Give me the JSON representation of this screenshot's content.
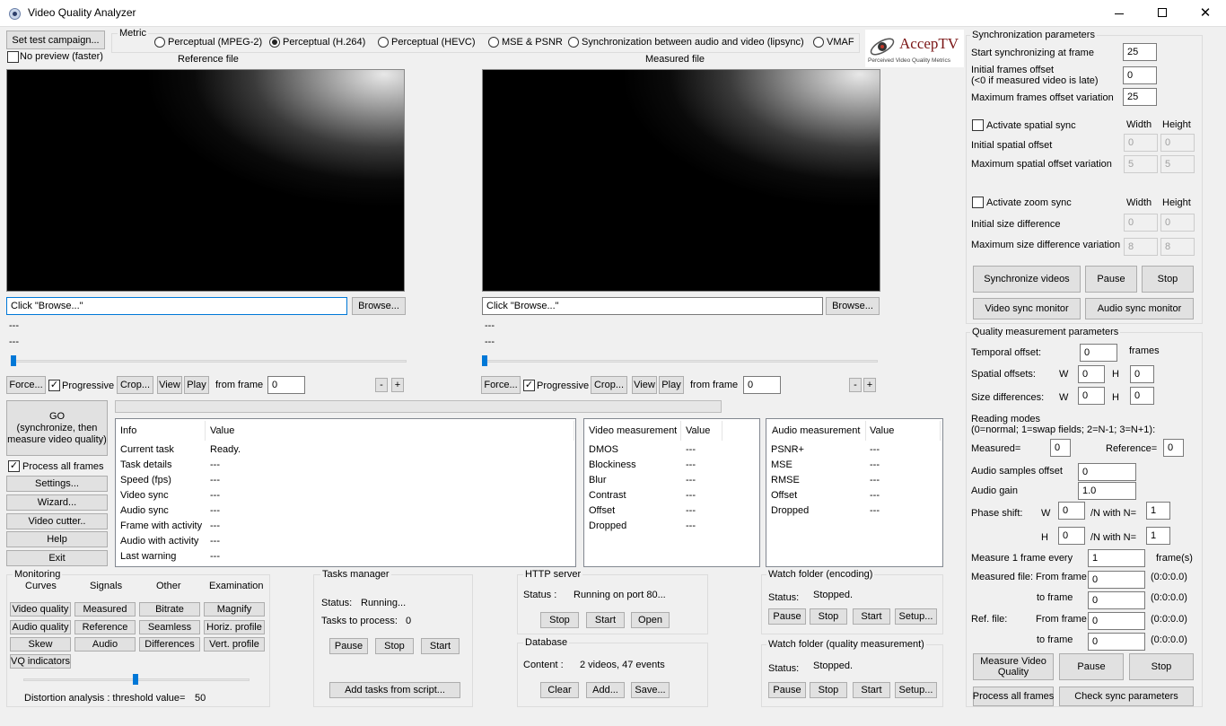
{
  "window": {
    "title": "Video Quality Analyzer"
  },
  "top": {
    "set_test_campaign": "Set test campaign...",
    "no_preview": "No preview (faster)",
    "metric_label": "Metric",
    "metrics": [
      "Perceptual (MPEG-2)",
      "Perceptual (H.264)",
      "Perceptual (HEVC)",
      "MSE & PSNR",
      "Synchronization between audio and video (lipsync)",
      "VMAF"
    ],
    "selected_metric": "Perceptual (H.264)"
  },
  "logo": {
    "name": "AccepTV",
    "tagline": "Perceived Video Quality Metrics"
  },
  "reference": {
    "title": "Reference file",
    "path": "Click \"Browse...\"",
    "browse": "Browse...",
    "info1": "---",
    "info2": "---",
    "force": "Force...",
    "progressive": "Progressive",
    "crop": "Crop...",
    "view": "View",
    "play": "Play",
    "from_frame_label": "from frame",
    "from_frame": "0",
    "minus": "-",
    "plus": "+"
  },
  "measured": {
    "title": "Measured file",
    "path": "Click \"Browse...\"",
    "browse": "Browse...",
    "info1": "---",
    "info2": "---",
    "force": "Force...",
    "progressive": "Progressive",
    "crop": "Crop...",
    "view": "View",
    "play": "Play",
    "from_frame_label": "from frame",
    "from_frame": "0",
    "minus": "-",
    "plus": "+"
  },
  "left_buttons": {
    "go": "GO\n(synchronize, then measure video quality)",
    "process_all_frames": "Process all frames",
    "settings": "Settings...",
    "wizard": "Wizard...",
    "video_cutter": "Video cutter..",
    "help": "Help",
    "exit": "Exit"
  },
  "info_table": {
    "headers": [
      "Info",
      "Value"
    ],
    "rows": [
      [
        "Current task",
        "Ready."
      ],
      [
        "Task details",
        "---"
      ],
      [
        "Speed (fps)",
        "---"
      ],
      [
        "Video sync",
        "---"
      ],
      [
        "Audio sync",
        "---"
      ],
      [
        "Frame with activity",
        "---"
      ],
      [
        "Audio with activity",
        "---"
      ],
      [
        "Last warning",
        "---"
      ]
    ]
  },
  "video_table": {
    "headers": [
      "Video measurement",
      "Value"
    ],
    "rows": [
      [
        "DMOS",
        "---"
      ],
      [
        "Blockiness",
        "---"
      ],
      [
        "Blur",
        "---"
      ],
      [
        "Contrast",
        "---"
      ],
      [
        "Offset",
        "---"
      ],
      [
        "Dropped",
        "---"
      ]
    ]
  },
  "audio_table": {
    "headers": [
      "Audio measurement",
      "Value"
    ],
    "rows": [
      [
        "PSNR+",
        "---"
      ],
      [
        "MSE",
        "---"
      ],
      [
        "RMSE",
        "---"
      ],
      [
        "Offset",
        "---"
      ],
      [
        "Dropped",
        "---"
      ]
    ]
  },
  "monitoring": {
    "title": "Monitoring",
    "cols": [
      "Curves",
      "Signals",
      "Other",
      "Examination"
    ],
    "buttons": [
      "Video quality",
      "Measured",
      "Bitrate",
      "Magnify",
      "Audio quality",
      "Reference",
      "Seamless",
      "Horiz. profile",
      "Skew",
      "Audio",
      "Differences",
      "Vert. profile",
      "VQ indicators"
    ],
    "threshold_label": "Distortion analysis : threshold value=",
    "threshold_value": "50"
  },
  "tasks": {
    "title": "Tasks manager",
    "status_label": "Status:",
    "status": "Running...",
    "to_process_label": "Tasks to process:",
    "to_process": "0",
    "pause": "Pause",
    "stop": "Stop",
    "start": "Start",
    "add_script": "Add tasks from script..."
  },
  "http": {
    "title": "HTTP server",
    "status_label": "Status :",
    "status": "Running on port 80...",
    "stop": "Stop",
    "start": "Start",
    "open": "Open"
  },
  "database": {
    "title": "Database",
    "content_label": "Content :",
    "content": "2 videos, 47 events",
    "clear": "Clear",
    "add": "Add...",
    "save": "Save..."
  },
  "watch_enc": {
    "title": "Watch folder (encoding)",
    "status_label": "Status:",
    "status": "Stopped.",
    "pause": "Pause",
    "stop": "Stop",
    "start": "Start",
    "setup": "Setup..."
  },
  "watch_qm": {
    "title": "Watch folder (quality measurement)",
    "status_label": "Status:",
    "status": "Stopped.",
    "pause": "Pause",
    "stop": "Stop",
    "start": "Start",
    "setup": "Setup..."
  },
  "sync": {
    "title": "Synchronization parameters",
    "start_label": "Start synchronizing at frame",
    "start": "25",
    "init_offset_label": "Initial frames offset",
    "init_offset_note": "(<0 if measured video is late)",
    "init_offset": "0",
    "max_var_label": "Maximum frames offset variation",
    "max_var": "25",
    "spatial_label": "Activate spatial sync",
    "width": "Width",
    "height": "Height",
    "init_spatial_label": "Initial spatial offset",
    "init_spatial_w": "0",
    "init_spatial_h": "0",
    "max_spatial_label": "Maximum spatial offset variation",
    "max_spatial_w": "5",
    "max_spatial_h": "5",
    "zoom_label": "Activate zoom sync",
    "init_size_label": "Initial size difference",
    "init_size_w": "0",
    "init_size_h": "0",
    "max_size_label": "Maximum size difference variation",
    "max_size_w": "8",
    "max_size_h": "8",
    "sync_videos": "Synchronize videos",
    "pause": "Pause",
    "stop": "Stop",
    "video_monitor": "Video sync monitor",
    "audio_monitor": "Audio sync monitor"
  },
  "quality": {
    "title": "Quality measurement parameters",
    "temporal_label": "Temporal offset:",
    "temporal": "0",
    "frames": "frames",
    "spatial_label": "Spatial offsets:",
    "w": "W",
    "h": "H",
    "spatial_w": "0",
    "spatial_h": "0",
    "size_label": "Size differences:",
    "size_w": "0",
    "size_h": "0",
    "reading_label": "Reading modes",
    "reading_note": "(0=normal; 1=swap fields; 2=N-1; 3=N+1):",
    "measured_label": "Measured=",
    "measured": "0",
    "reference_label": "Reference=",
    "reference": "0",
    "audio_offset_label": "Audio samples offset",
    "audio_offset": "0",
    "audio_gain_label": "Audio gain",
    "audio_gain": "1.0",
    "phase_label": "Phase shift:",
    "with_n": "/N with N=",
    "phase_w": "0",
    "phase_w_n": "1",
    "phase_h": "0",
    "phase_h_n": "1",
    "measure_every_label": "Measure 1 frame every",
    "measure_every": "1",
    "frames_unit": "frame(s)",
    "meas_file_label": "Measured file:",
    "from_frame": "From frame",
    "to_frame": "to frame",
    "meas_from": "0",
    "meas_from_tc": "(0:0:0.0)",
    "meas_to": "0",
    "meas_to_tc": "(0:0:0.0)",
    "ref_file_label": "Ref. file:",
    "ref_from": "0",
    "ref_from_tc": "(0:0:0.0)",
    "ref_to": "0",
    "ref_to_tc": "(0:0:0.0)",
    "measure_vq": "Measure Video Quality",
    "pause": "Pause",
    "stop": "Stop",
    "process_all": "Process all frames",
    "check_sync": "Check sync parameters"
  }
}
